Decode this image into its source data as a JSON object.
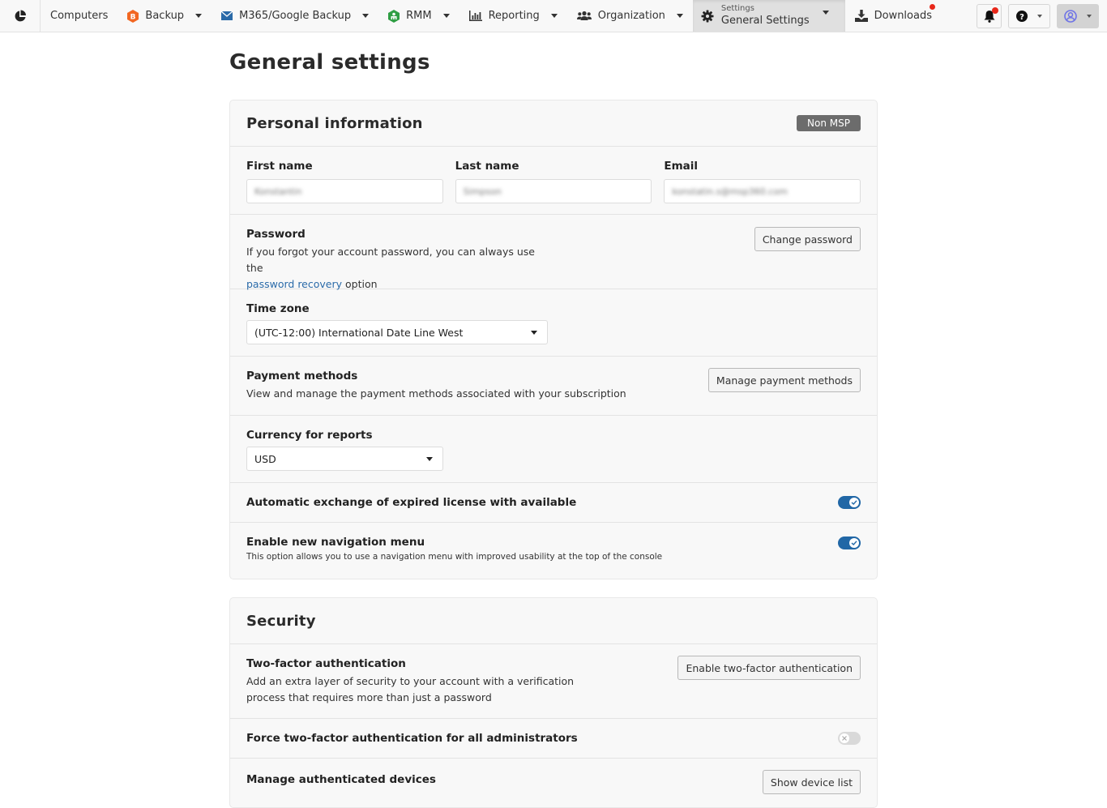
{
  "nav": {
    "items": [
      {
        "label": "Computers",
        "icon": "none"
      },
      {
        "label": "Backup",
        "icon": "backup-hex-icon",
        "color": "#f26722"
      },
      {
        "label": "M365/Google Backup",
        "icon": "envelope-icon",
        "color": "#2a6aa8"
      },
      {
        "label": "RMM",
        "icon": "rmm-icon",
        "color": "#2f9e44"
      },
      {
        "label": "Reporting",
        "icon": "bar-chart-icon"
      },
      {
        "label": "Organization",
        "icon": "users-icon"
      }
    ],
    "active": {
      "small": "Settings",
      "label": "General Settings",
      "icon": "gear-icon"
    },
    "downloads": {
      "label": "Downloads",
      "icon": "download-icon",
      "has_notification": true
    },
    "notification_dot_color": "#e8271a"
  },
  "page": {
    "title": "General settings"
  },
  "personal": {
    "title": "Personal information",
    "badge": "Non MSP",
    "first_name": {
      "label": "First name",
      "value": "Konstantin"
    },
    "last_name": {
      "label": "Last name",
      "value": "Simpson"
    },
    "email": {
      "label": "Email",
      "value": "konstatin.s@msp360.com"
    },
    "password": {
      "label": "Password",
      "desc_before": "If you forgot your account password, you can always use the",
      "link": "password recovery",
      "desc_after": " option",
      "button": "Change password"
    },
    "timezone": {
      "label": "Time zone",
      "value": "(UTC-12:00) International Date Line West"
    },
    "payment": {
      "label": "Payment methods",
      "desc": "View and manage the payment methods associated with your subscription",
      "button": "Manage payment methods"
    },
    "currency": {
      "label": "Currency for reports",
      "value": "USD"
    },
    "auto_exchange": {
      "label": "Automatic exchange of expired license with available",
      "enabled": true
    },
    "new_nav": {
      "label": "Enable new navigation menu",
      "desc": "This option allows you to use a navigation menu with improved usability at the top of the console",
      "enabled": true
    }
  },
  "security": {
    "title": "Security",
    "two_factor": {
      "label": "Two-factor authentication",
      "desc_line1": "Add an extra layer of security to your account with a verification",
      "desc_line2": "process that requires more than just a password",
      "button": "Enable two-factor authentication"
    },
    "force_2fa": {
      "label": "Force two-factor authentication for all administrators",
      "enabled": false
    },
    "devices": {
      "label": "Manage authenticated devices",
      "button": "Show device list"
    }
  },
  "colors": {
    "accent": "#2167a6",
    "link": "#2a6aa8",
    "badge": "#6c6c6c"
  }
}
